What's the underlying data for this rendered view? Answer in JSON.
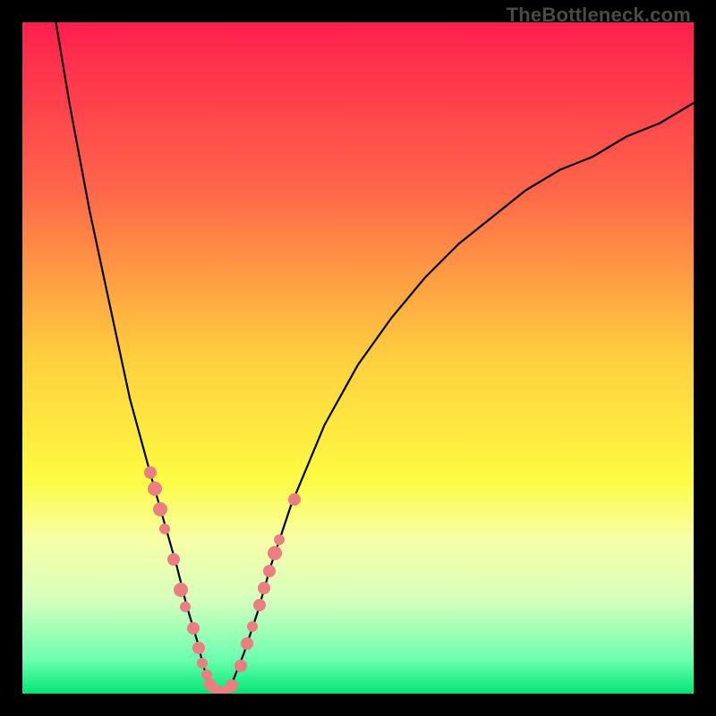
{
  "watermark": "TheBottleneck.com",
  "chart_data": {
    "type": "line",
    "title": "",
    "xlabel": "",
    "ylabel": "",
    "xlim": [
      0,
      100
    ],
    "ylim": [
      0,
      100
    ],
    "background_gradient_stops": [
      {
        "pos": 0,
        "color": "#ff1f4f"
      },
      {
        "pos": 25,
        "color": "#ff664a"
      },
      {
        "pos": 50,
        "color": "#ffcf3e"
      },
      {
        "pos": 68,
        "color": "#fdfb42"
      },
      {
        "pos": 77,
        "color": "#f7ffa6"
      },
      {
        "pos": 86,
        "color": "#d6ffbd"
      },
      {
        "pos": 95,
        "color": "#6bffaf"
      },
      {
        "pos": 100,
        "color": "#00e676"
      }
    ],
    "series": [
      {
        "name": "bottleneck-curve",
        "x": [
          5,
          7,
          10,
          13,
          16,
          19,
          21,
          23,
          24.5,
          26,
          27,
          28,
          29,
          31,
          33,
          35,
          37,
          40,
          45,
          50,
          55,
          60,
          65,
          70,
          75,
          80,
          85,
          90,
          95,
          100
        ],
        "y": [
          100,
          88,
          72,
          58,
          44,
          33,
          26,
          19,
          13,
          8,
          4,
          1,
          0,
          1,
          6,
          12,
          19,
          28,
          40,
          49,
          56,
          62,
          67,
          71,
          75,
          78,
          80,
          83,
          85,
          88
        ]
      }
    ],
    "markers": {
      "name": "sample-points",
      "color": "#eb7e80",
      "points": [
        {
          "x": 19.0,
          "y": 33.0,
          "r": 7
        },
        {
          "x": 19.7,
          "y": 30.5,
          "r": 8
        },
        {
          "x": 20.5,
          "y": 27.5,
          "r": 8
        },
        {
          "x": 21.2,
          "y": 24.5,
          "r": 6
        },
        {
          "x": 22.5,
          "y": 20.0,
          "r": 7
        },
        {
          "x": 23.6,
          "y": 15.5,
          "r": 8
        },
        {
          "x": 24.2,
          "y": 13.0,
          "r": 6
        },
        {
          "x": 25.4,
          "y": 9.7,
          "r": 7
        },
        {
          "x": 26.3,
          "y": 6.8,
          "r": 7
        },
        {
          "x": 26.8,
          "y": 4.5,
          "r": 6
        },
        {
          "x": 27.4,
          "y": 2.8,
          "r": 6
        },
        {
          "x": 28.0,
          "y": 1.4,
          "r": 7
        },
        {
          "x": 29.0,
          "y": 0.4,
          "r": 7
        },
        {
          "x": 30.0,
          "y": 0.2,
          "r": 7
        },
        {
          "x": 31.2,
          "y": 1.2,
          "r": 7
        },
        {
          "x": 32.5,
          "y": 4.2,
          "r": 7
        },
        {
          "x": 33.5,
          "y": 7.5,
          "r": 7
        },
        {
          "x": 34.2,
          "y": 10.0,
          "r": 6
        },
        {
          "x": 35.3,
          "y": 13.2,
          "r": 7
        },
        {
          "x": 36.0,
          "y": 15.8,
          "r": 7
        },
        {
          "x": 36.8,
          "y": 18.3,
          "r": 7
        },
        {
          "x": 37.6,
          "y": 21.0,
          "r": 8
        },
        {
          "x": 38.2,
          "y": 23.0,
          "r": 6
        },
        {
          "x": 40.5,
          "y": 29.0,
          "r": 7
        }
      ]
    }
  }
}
